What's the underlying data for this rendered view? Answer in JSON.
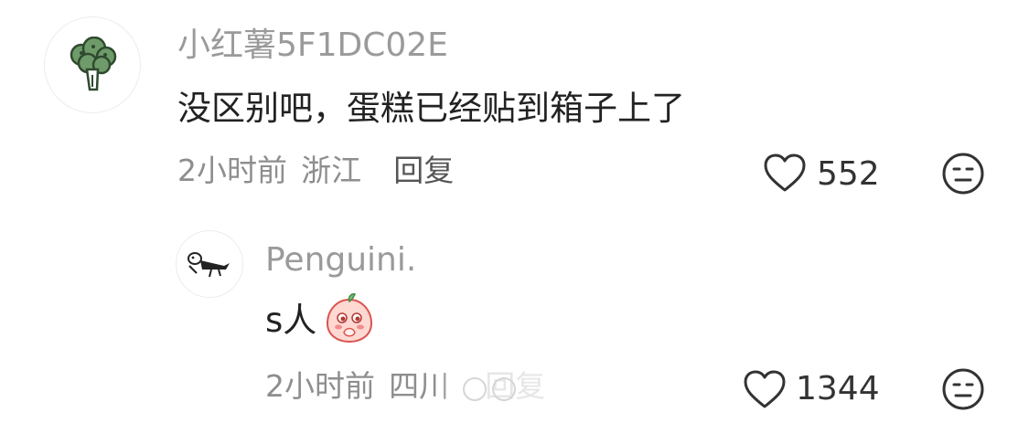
{
  "comment1": {
    "username": "小红薯5F1DC02E",
    "text": "没区别吧，蛋糕已经贴到箱子上了",
    "time": "2小时前",
    "location": "浙江",
    "reply_label": "回复",
    "like_count": "552",
    "avatar_icon": "broccoli-icon"
  },
  "reply1": {
    "username": "Penguini.",
    "text": "s人",
    "emoji_icon": "peach-covering-mouth-emoji",
    "time": "2小时前",
    "location": "四川",
    "reply_label": "回复",
    "like_count": "1344",
    "avatar_icon": "penguin-sketch-icon"
  },
  "icons": {
    "like": "heart-outline-icon",
    "dislike": "neutral-face-icon"
  },
  "colors": {
    "username": "#9a9a9a",
    "text": "#222222",
    "meta": "#8e8e8e",
    "broccoli": "#5c8a5c"
  }
}
